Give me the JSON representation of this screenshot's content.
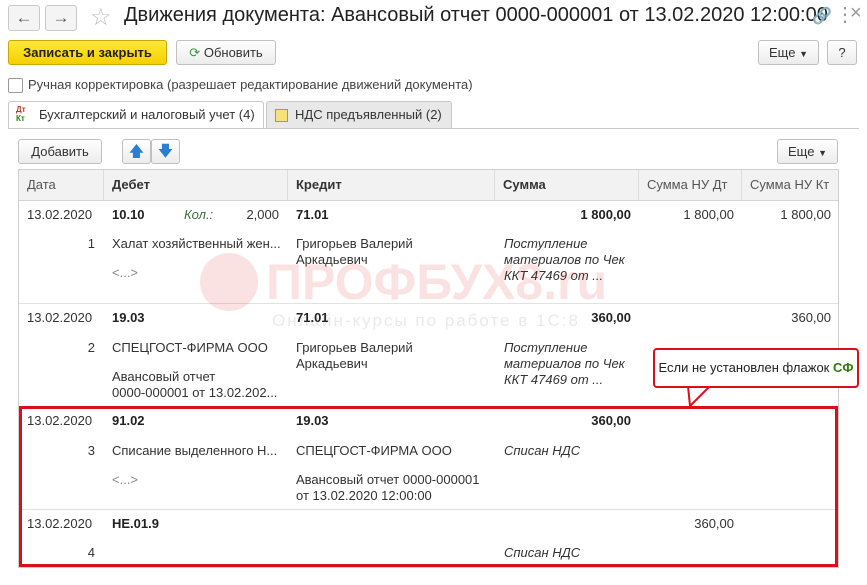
{
  "window": {
    "title": "Движения документа: Авансовый отчет 0000-000001 от 13.02.2020 12:00:00"
  },
  "toolbar": {
    "save_close": "Записать и закрыть",
    "refresh": "Обновить",
    "more": "Еще",
    "help": "?"
  },
  "manual": {
    "label": "Ручная корректировка (разрешает редактирование движений документа)"
  },
  "tabs": [
    {
      "label": "Бухгалтерский и налоговый учет (4)",
      "icon": "dt-kt-icon"
    },
    {
      "label": "НДС предъявленный (2)",
      "icon": "register-icon"
    }
  ],
  "table_toolbar": {
    "add": "Добавить",
    "more": "Еще"
  },
  "columns": [
    "Дата",
    "Дебет",
    "Кредит",
    "Сумма",
    "Сумма НУ Дт",
    "Сумма НУ Кт"
  ],
  "rows": [
    {
      "date": "13.02.2020",
      "num": "1",
      "debit": "10.10",
      "kol_label": "Кол.:",
      "kol_value": "2,000",
      "debit_sub1": "Халат хозяйственный жен...",
      "debit_sub2": "<...>",
      "credit": "71.01",
      "credit_sub1": "Григорьев Валерий",
      "credit_sub2": "Аркадьевич",
      "sum": "1 800,00",
      "content1": "Поступление",
      "content2": "материалов по Чек",
      "content3": "ККТ  47469 от ...",
      "nu_dt": "1 800,00",
      "nu_kt": "1 800,00"
    },
    {
      "date": "13.02.2020",
      "num": "2",
      "debit": "19.03",
      "debit_sub1": "СПЕЦГОСТ-ФИРМА ООО",
      "debit_sub2": "Авансовый отчет",
      "debit_sub3": "0000-000001 от 13.02.202...",
      "credit": "71.01",
      "credit_sub1": "Григорьев Валерий",
      "credit_sub2": "Аркадьевич",
      "sum": "360,00",
      "content1": "Поступление",
      "content2": "материалов по Чек",
      "content3": "ККТ  47469 от ...",
      "nu_dt": "",
      "nu_kt": "360,00"
    },
    {
      "date": "13.02.2020",
      "num": "3",
      "debit": "91.02",
      "debit_sub1": "Списание выделенного Н...",
      "debit_sub2": "<...>",
      "credit": "19.03",
      "credit_sub1": "СПЕЦГОСТ-ФИРМА ООО",
      "credit_sub2": "Авансовый отчет 0000-000001",
      "credit_sub3": "от 13.02.2020 12:00:00",
      "sum": "360,00",
      "content1": "Списан НДС",
      "nu_dt": "",
      "nu_kt": ""
    },
    {
      "date": "13.02.2020",
      "num": "4",
      "debit": "НЕ.01.9",
      "sum": "",
      "content1": "Списан НДС",
      "nu_dt": "360,00",
      "nu_kt": ""
    }
  ],
  "callout": {
    "text": "Если не установлен флажок",
    "highlight": "СФ"
  },
  "watermark": {
    "brand": "ПРОФБУХ8.ru",
    "tagline": "Онлайн-курсы по работе в 1С:8"
  },
  "colors": {
    "accent_yellow": "#f5d000",
    "highlight_red": "#d9101b",
    "callout_green": "#2e7d0a"
  }
}
